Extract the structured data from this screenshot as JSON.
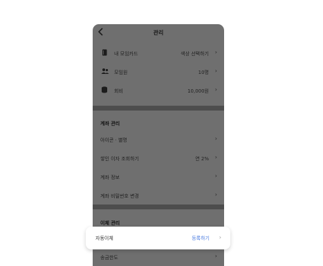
{
  "header": {
    "title": "관리"
  },
  "summary": [
    {
      "icon": "card-icon",
      "label": "내 모임카드",
      "value": "색상 선택하기"
    },
    {
      "icon": "people-icon",
      "label": "모임원",
      "value": "10명"
    },
    {
      "icon": "coin-stack-icon",
      "label": "회비",
      "value": "10,000원"
    }
  ],
  "account_section": {
    "title": "계좌 관리",
    "items": [
      {
        "label": "아이콘 · 별명",
        "value": ""
      },
      {
        "label": "쌓인 이자 조회하기",
        "value": "연 2%"
      },
      {
        "label": "계좌 정보",
        "value": ""
      },
      {
        "label": "계좌 비밀번호 변경",
        "value": ""
      }
    ]
  },
  "transfer_section": {
    "title": "이체 관리",
    "auto_transfer": {
      "label": "자동이체",
      "value": "등록하기"
    },
    "limit": {
      "label": "송금한도",
      "value": ""
    }
  },
  "colors": {
    "overlay": "#6f6f6f",
    "divider": "#4d4d4d",
    "accent": "#4a7be0"
  }
}
